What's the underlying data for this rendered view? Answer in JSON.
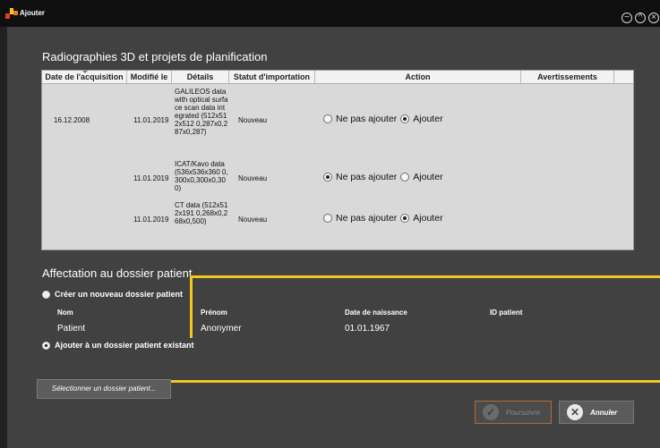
{
  "window": {
    "title": "Ajouter"
  },
  "section1": {
    "title": "Radiographies 3D et projets de planification"
  },
  "table": {
    "headers": [
      "Date de l'acquisition",
      "Modifié le",
      "Détails",
      "Statut d'importation",
      "Action",
      "Avertissements"
    ],
    "rows": [
      {
        "date": "16.12.2008",
        "modified": "11.01.2019",
        "details": "GALILEOS data with optical surface scan data integrated (512x512x512 0,287x0,287x0,287)",
        "status": "Nouveau",
        "choice": "Ajouter"
      },
      {
        "date": "",
        "modified": "11.01.2019",
        "details": "ICAT/Kavo data (536x536x360 0,300x0,300x0,300)",
        "status": "Nouveau",
        "choice": "Ne pas ajouter"
      },
      {
        "date": "",
        "modified": "11.01.2019",
        "details": "CT data (512x512x191 0,268x0,268x0,500)",
        "status": "Nouveau",
        "choice": "Ajouter"
      }
    ],
    "action_labels": {
      "skip": "Ne pas ajouter",
      "add": "Ajouter"
    }
  },
  "section2": {
    "title": "Affectation au dossier patient",
    "option_new": "Créer un nouveau dossier patient",
    "option_existing": "Ajouter à un dossier patient existant",
    "selected_option": "existing"
  },
  "patient": {
    "labels": {
      "name": "Nom",
      "firstname": "Prénom",
      "birthdate": "Date de naissance",
      "id": "ID patient"
    },
    "values": {
      "name": "Patient",
      "firstname": "Anonymer",
      "birthdate": "01.01.1967",
      "id": ""
    }
  },
  "buttons": {
    "select_patient": "Sélectionner un dossier patient...",
    "continue": "Poursuivre",
    "cancel": "Annuler"
  },
  "icons": [
    "app-logo-icon",
    "minimize-icon",
    "maximize-icon",
    "close-icon",
    "check-icon",
    "cancel-x-icon"
  ],
  "colors": {
    "accent": "#f3c620",
    "background": "#414141",
    "titlebar": "#0f0f0f"
  }
}
